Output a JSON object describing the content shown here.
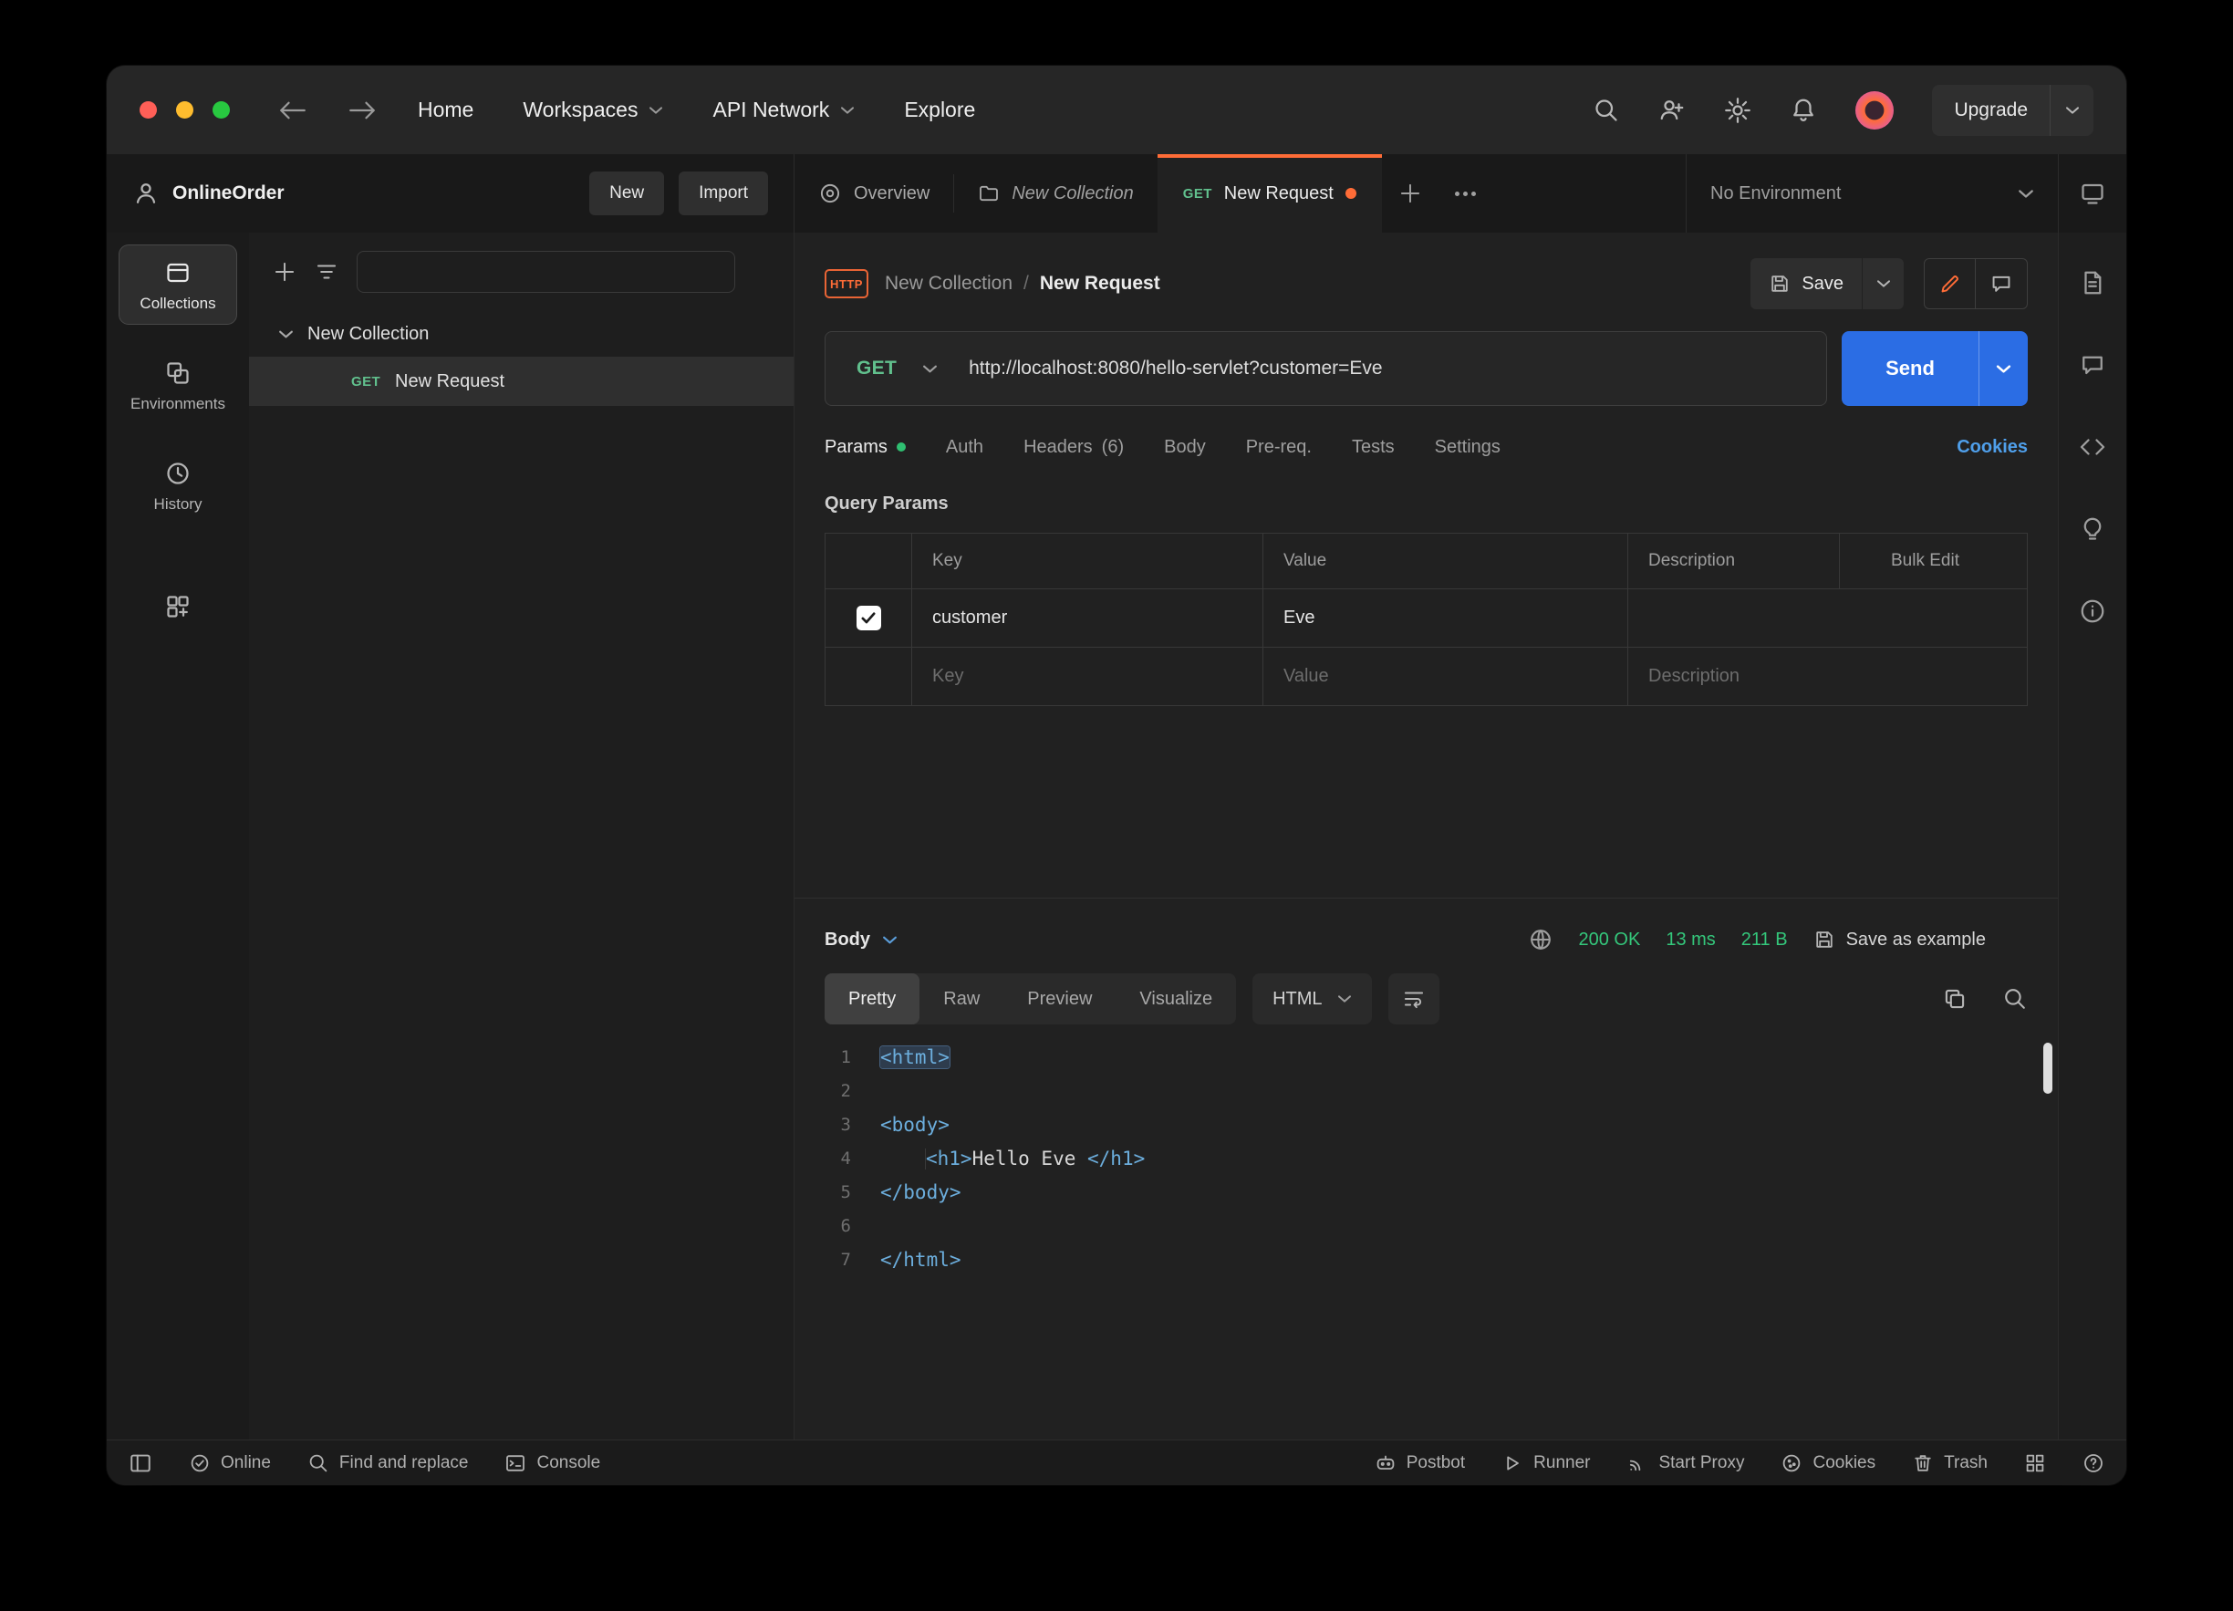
{
  "topnav": {
    "home": "Home",
    "workspaces": "Workspaces",
    "api_network": "API Network",
    "explore": "Explore",
    "upgrade": "Upgrade"
  },
  "workspace_header": {
    "name": "OnlineOrder",
    "new": "New",
    "import": "Import"
  },
  "tabbar": {
    "overview": "Overview",
    "collection_tab": "New Collection",
    "request_tab_method": "GET",
    "request_tab_label": "New Request",
    "environment": "No Environment"
  },
  "sidebar": {
    "collections": "Collections",
    "environments": "Environments",
    "history": "History",
    "tree_collection": "New Collection",
    "tree_request_method": "GET",
    "tree_request_label": "New Request"
  },
  "request": {
    "protocol_badge": "HTTP",
    "breadcrumb_collection": "New Collection",
    "breadcrumb_separator": "/",
    "breadcrumb_request": "New Request",
    "save": "Save",
    "method": "GET",
    "url": "http://localhost:8080/hello-servlet?customer=Eve",
    "send": "Send",
    "tabs": [
      {
        "label": "Params"
      },
      {
        "label": "Auth"
      },
      {
        "label": "Headers",
        "count": "(6)"
      },
      {
        "label": "Body"
      },
      {
        "label": "Pre-req."
      },
      {
        "label": "Tests"
      },
      {
        "label": "Settings"
      }
    ],
    "cookies": "Cookies",
    "query_params": {
      "title": "Query Params",
      "col_key": "Key",
      "col_value": "Value",
      "col_description": "Description",
      "bulk_edit": "Bulk Edit",
      "row": {
        "key": "customer",
        "value": "Eve",
        "description": "",
        "checked": true
      },
      "placeholder": {
        "key": "Key",
        "value": "Value",
        "description": "Description"
      }
    }
  },
  "response": {
    "body_label": "Body",
    "status": "200 OK",
    "time": "13 ms",
    "size": "211 B",
    "save_as_example": "Save as example",
    "views": [
      {
        "label": "Pretty",
        "active": true
      },
      {
        "label": "Raw"
      },
      {
        "label": "Preview"
      },
      {
        "label": "Visualize"
      }
    ],
    "format": "HTML",
    "code": {
      "lines": [
        {
          "num": "1",
          "tokens": [
            {
              "t": "tag",
              "v": "<html>",
              "hl": true
            }
          ]
        },
        {
          "num": "2",
          "tokens": []
        },
        {
          "num": "3",
          "tokens": [
            {
              "t": "tag",
              "v": "<body>"
            }
          ]
        },
        {
          "num": "4",
          "tokens": [
            {
              "t": "indent",
              "v": "    "
            },
            {
              "t": "tag",
              "v": "<h1>"
            },
            {
              "t": "text",
              "v": "Hello Eve "
            },
            {
              "t": "tag",
              "v": "</h1>"
            }
          ]
        },
        {
          "num": "5",
          "tokens": [
            {
              "t": "tag",
              "v": "</body>"
            }
          ]
        },
        {
          "num": "6",
          "tokens": []
        },
        {
          "num": "7",
          "tokens": [
            {
              "t": "tag",
              "v": "</html>"
            }
          ]
        }
      ]
    }
  },
  "statusbar": {
    "online": "Online",
    "find": "Find and replace",
    "console": "Console",
    "postbot": "Postbot",
    "runner": "Runner",
    "proxy": "Start Proxy",
    "cookies": "Cookies",
    "trash": "Trash"
  },
  "colors": {
    "accent_orange": "#ff6c37",
    "send_blue": "#2b6de4",
    "success_green": "#2fbf71",
    "link_blue": "#4f9fea",
    "method_get_green": "#61c08d"
  }
}
